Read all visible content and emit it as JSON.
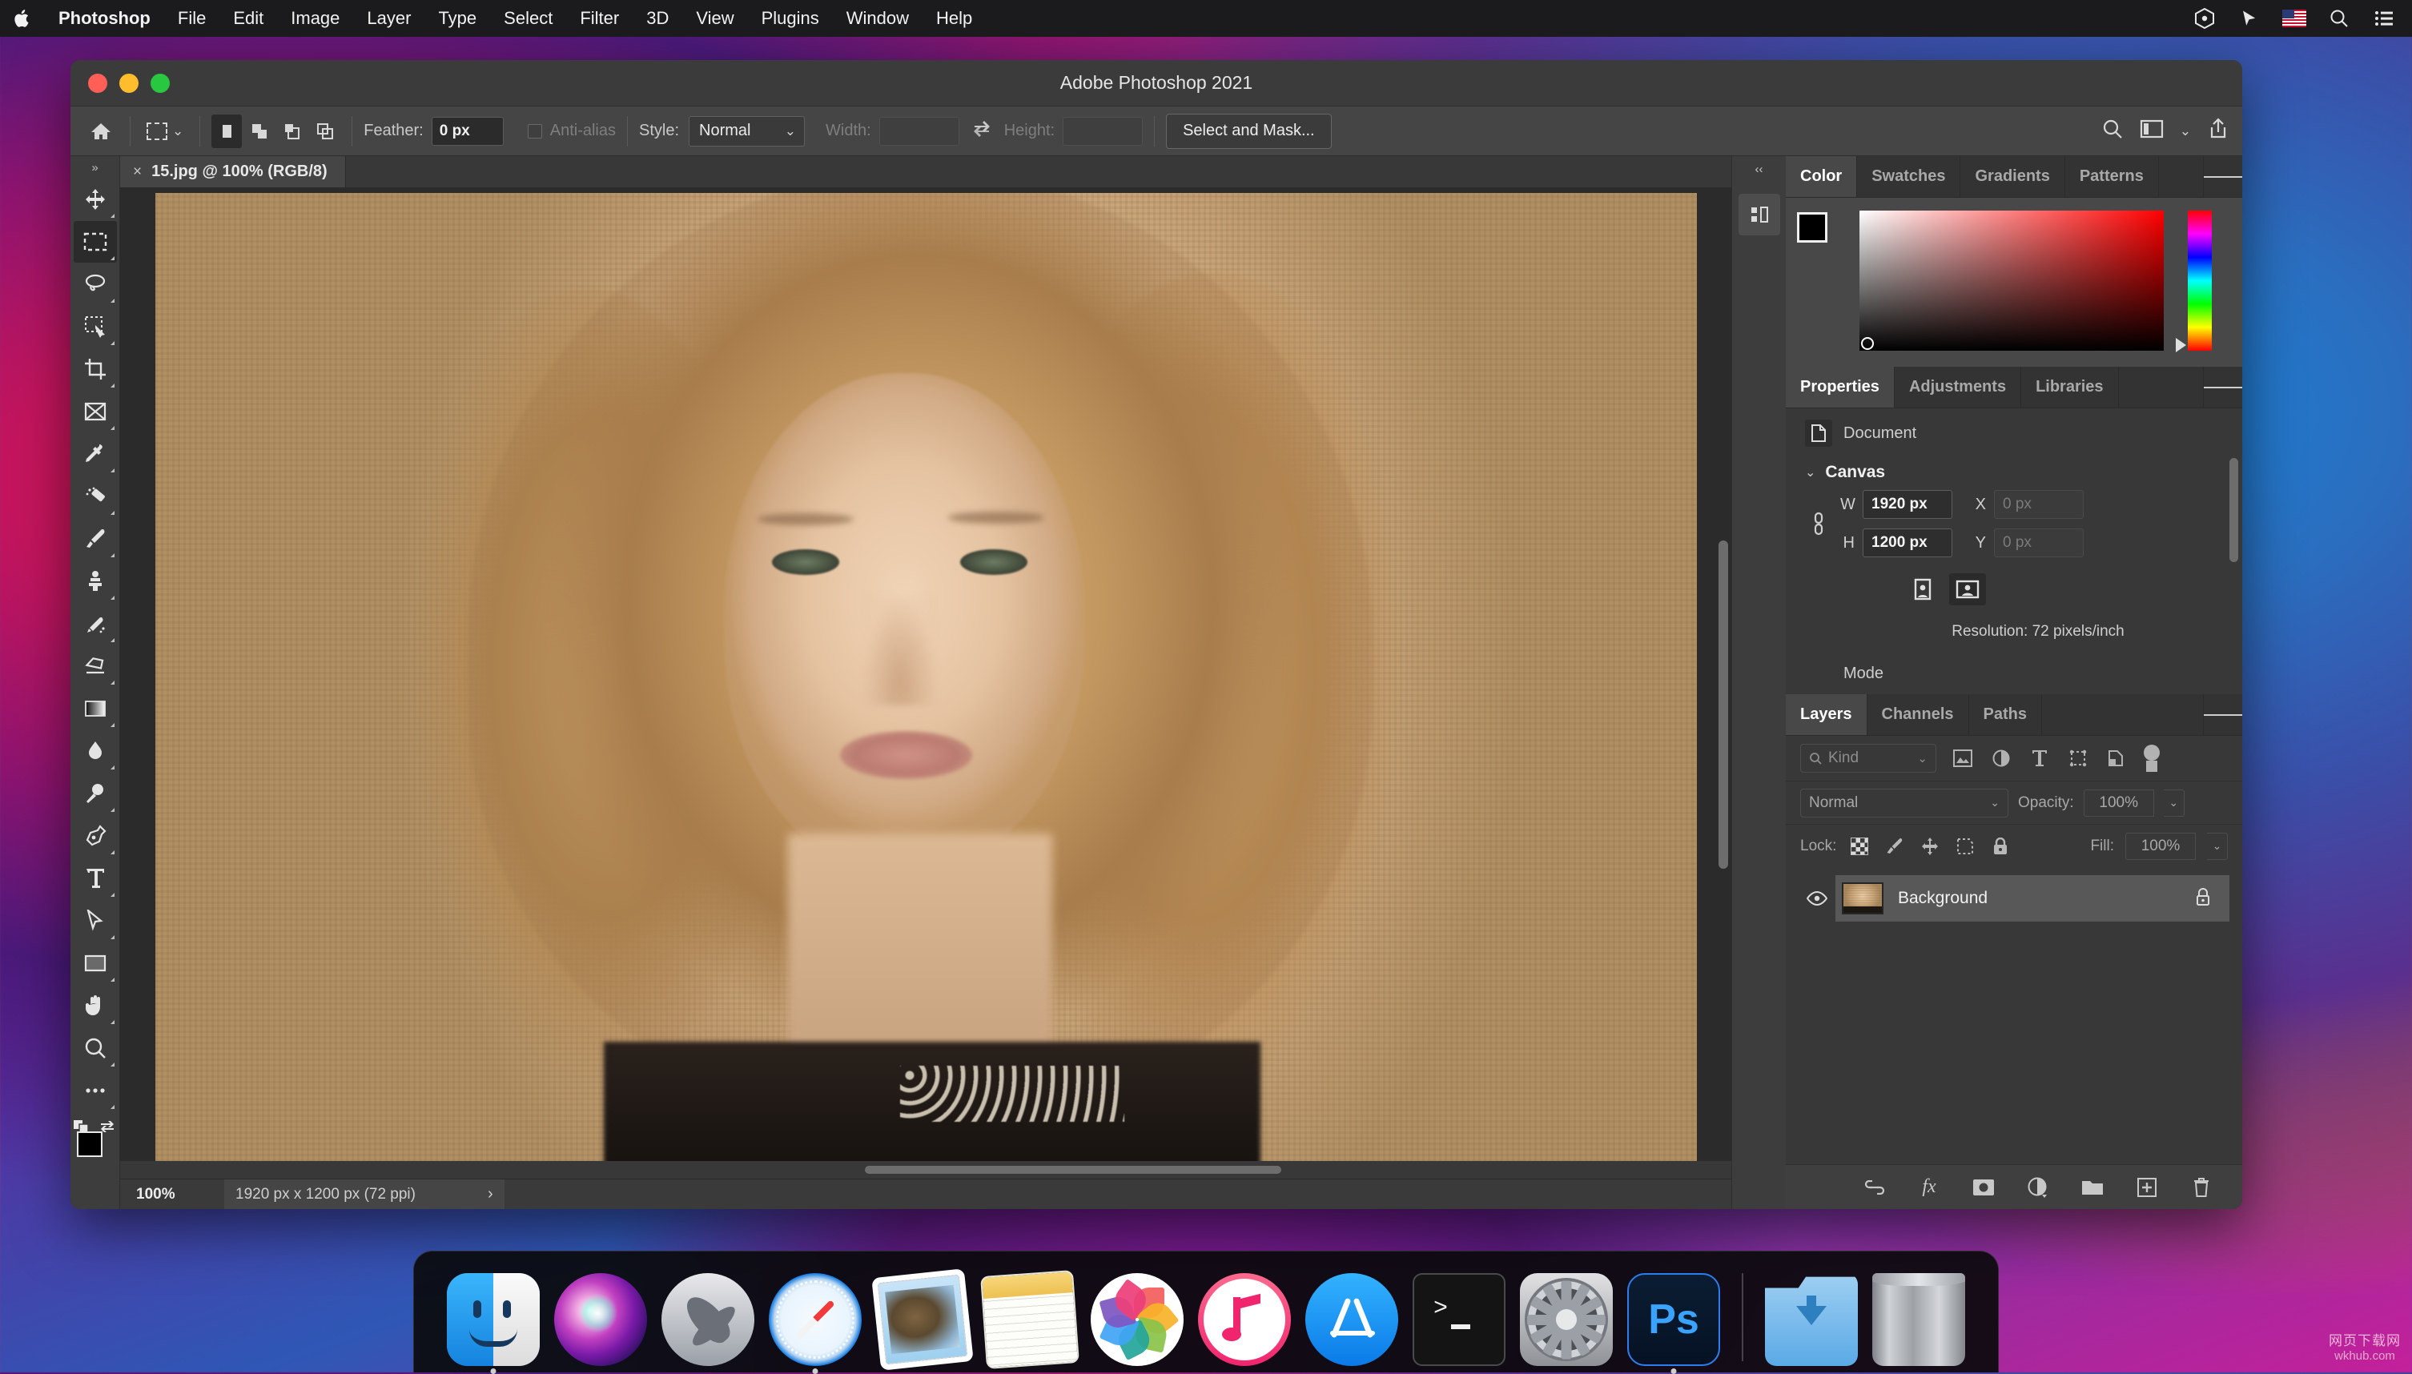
{
  "menubar": {
    "apple_icon": "apple-icon",
    "items": [
      {
        "label": "Photoshop",
        "bold": true
      },
      {
        "label": "File",
        "bold": false
      },
      {
        "label": "Edit",
        "bold": false
      },
      {
        "label": "Image",
        "bold": false
      },
      {
        "label": "Layer",
        "bold": false
      },
      {
        "label": "Type",
        "bold": false
      },
      {
        "label": "Select",
        "bold": false
      },
      {
        "label": "Filter",
        "bold": false
      },
      {
        "label": "3D",
        "bold": false
      },
      {
        "label": "View",
        "bold": false
      },
      {
        "label": "Plugins",
        "bold": false
      },
      {
        "label": "Window",
        "bold": false
      },
      {
        "label": "Help",
        "bold": false
      }
    ],
    "status_icons": [
      "avast-icon",
      "cursor-pointer-icon",
      "us-flag-icon",
      "spotlight-search-icon",
      "control-center-icon"
    ]
  },
  "window": {
    "title": "Adobe Photoshop 2021",
    "traffic_lights": [
      "close",
      "minimize",
      "maximize"
    ]
  },
  "options_bar": {
    "home_icon": "home-icon",
    "tool_icon": "rectangular-marquee-icon",
    "tool_dropdown": "chevron-down-icon",
    "selection_modes": [
      "new-selection",
      "add-to-selection",
      "subtract-from-selection",
      "intersect-selection"
    ],
    "feather_label": "Feather:",
    "feather_value": "0 px",
    "antialias_label": "Anti-alias",
    "style_label": "Style:",
    "style_value": "Normal",
    "width_label": "Width:",
    "width_value": "",
    "swap_icon": "swap-arrows-icon",
    "height_label": "Height:",
    "height_value": "",
    "select_and_mask": "Select and Mask...",
    "right_icons": [
      "search-icon",
      "workspace-icon",
      "chevron-down-icon",
      "share-icon"
    ]
  },
  "toolbar": {
    "collapse": "»",
    "tools": [
      {
        "name": "move-tool",
        "active": false
      },
      {
        "name": "rectangular-marquee-tool",
        "active": true
      },
      {
        "name": "lasso-tool",
        "active": false
      },
      {
        "name": "quick-selection-tool",
        "active": false
      },
      {
        "name": "crop-tool",
        "active": false
      },
      {
        "name": "frame-tool",
        "active": false
      },
      {
        "name": "eyedropper-tool",
        "active": false
      },
      {
        "name": "spot-healing-brush-tool",
        "active": false
      },
      {
        "name": "brush-tool",
        "active": false
      },
      {
        "name": "clone-stamp-tool",
        "active": false
      },
      {
        "name": "history-brush-tool",
        "active": false
      },
      {
        "name": "eraser-tool",
        "active": false
      },
      {
        "name": "gradient-tool",
        "active": false
      },
      {
        "name": "blur-tool",
        "active": false
      },
      {
        "name": "dodge-tool",
        "active": false
      },
      {
        "name": "pen-tool",
        "active": false
      },
      {
        "name": "type-tool",
        "active": false
      },
      {
        "name": "path-selection-tool",
        "active": false
      },
      {
        "name": "rectangle-tool",
        "active": false
      },
      {
        "name": "hand-tool",
        "active": false
      },
      {
        "name": "zoom-tool",
        "active": false
      },
      {
        "name": "edit-toolbar-tool",
        "active": false
      }
    ],
    "foreground_color": "#000000",
    "background_color": "#ffffff"
  },
  "document": {
    "tab_close": "×",
    "tab_title": "15.jpg @ 100% (RGB/8)"
  },
  "statusbar": {
    "zoom": "100%",
    "info": "1920 px x 1200 px (72 ppi)",
    "arrow": "›"
  },
  "right_dock": {
    "collapse": "‹‹",
    "button_icon": "panel-expand-icon"
  },
  "color_panel": {
    "tabs": [
      {
        "label": "Color",
        "active": true
      },
      {
        "label": "Swatches",
        "active": false
      },
      {
        "label": "Gradients",
        "active": false
      },
      {
        "label": "Patterns",
        "active": false
      }
    ],
    "menu_icon": "panel-menu-icon",
    "foreground": "#000000",
    "background": "#ffffff",
    "ramp_hue": "#ff0000"
  },
  "properties_panel": {
    "tabs": [
      {
        "label": "Properties",
        "active": true
      },
      {
        "label": "Adjustments",
        "active": false
      },
      {
        "label": "Libraries",
        "active": false
      }
    ],
    "menu_icon": "panel-menu-icon",
    "doc_icon": "document-icon",
    "doc_label": "Document",
    "section_title": "Canvas",
    "section_chevron": "chevron-down-icon",
    "link_icon": "link-dimensions-icon",
    "w_key": "W",
    "w_value": "1920 px",
    "h_key": "H",
    "h_value": "1200 px",
    "x_key": "X",
    "x_value": "0 px",
    "y_key": "Y",
    "y_value": "0 px",
    "orientation": [
      "portrait-orientation",
      "landscape-orientation"
    ],
    "orientation_active": 1,
    "resolution": "Resolution: 72 pixels/inch",
    "mode_label": "Mode"
  },
  "layers_panel": {
    "tabs": [
      {
        "label": "Layers",
        "active": true
      },
      {
        "label": "Channels",
        "active": false
      },
      {
        "label": "Paths",
        "active": false
      }
    ],
    "menu_icon": "panel-menu-icon",
    "filter_placeholder": "Kind",
    "filter_icons": [
      "pixel-layer-filter-icon",
      "adjustment-layer-filter-icon",
      "type-layer-filter-icon",
      "shape-layer-filter-icon",
      "smart-object-filter-icon"
    ],
    "filter_toggle": "filter-enable-toggle",
    "blend_mode": "Normal",
    "opacity_label": "Opacity:",
    "opacity_value": "100%",
    "lock_label": "Lock:",
    "lock_icons": [
      "lock-transparent-pixels-icon",
      "lock-image-pixels-icon",
      "lock-position-icon",
      "lock-artboard-icon",
      "lock-all-icon"
    ],
    "fill_label": "Fill:",
    "fill_value": "100%",
    "layers": [
      {
        "name": "Background",
        "visible": true,
        "locked": true,
        "selected": true
      }
    ],
    "bottom_icons": [
      "link-layers-icon",
      "layer-style-fx-icon",
      "add-layer-mask-icon",
      "new-adjustment-layer-icon",
      "new-group-icon",
      "new-layer-icon",
      "delete-layer-icon"
    ],
    "fx_label": "fx"
  },
  "dock": {
    "items": [
      {
        "name": "finder",
        "running": true
      },
      {
        "name": "siri",
        "running": false
      },
      {
        "name": "launchpad",
        "running": false
      },
      {
        "name": "safari",
        "running": true
      },
      {
        "name": "mail",
        "running": false
      },
      {
        "name": "notes",
        "running": false
      },
      {
        "name": "photos",
        "running": false
      },
      {
        "name": "music",
        "running": false
      },
      {
        "name": "app-store",
        "running": false
      },
      {
        "name": "terminal",
        "running": false
      },
      {
        "name": "system-preferences",
        "running": false
      },
      {
        "name": "photoshop",
        "running": true
      },
      {
        "name": "downloads-folder",
        "running": false
      },
      {
        "name": "trash",
        "running": false
      }
    ]
  },
  "watermark": {
    "line1": "网页下载网",
    "line2": "wkhub.com"
  }
}
